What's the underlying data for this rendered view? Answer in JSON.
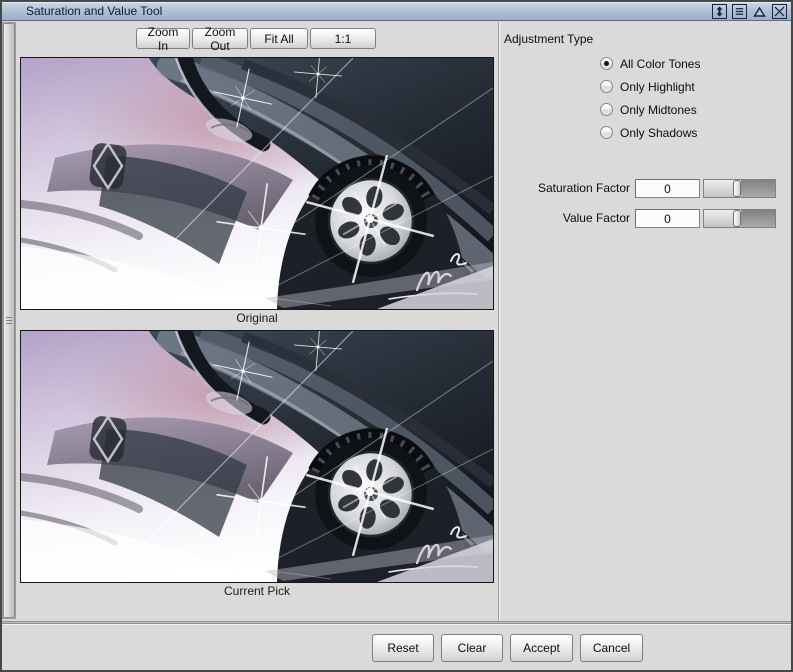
{
  "window": {
    "title": "Saturation and Value Tool",
    "controls": [
      "resize-vertical",
      "window-menu",
      "shade",
      "close"
    ]
  },
  "toolbar": {
    "buttons": [
      "Zoom In",
      "Zoom Out",
      "Fit All",
      "1:1"
    ]
  },
  "previews": {
    "content": "concept-car-sketch-minivan-front-wheel",
    "items": [
      {
        "label": "Original"
      },
      {
        "label": "Current Pick"
      }
    ]
  },
  "adjustment": {
    "group_label": "Adjustment Type",
    "options": [
      {
        "label": "All Color Tones",
        "selected": true
      },
      {
        "label": "Only Highlight",
        "selected": false
      },
      {
        "label": "Only Midtones",
        "selected": false
      },
      {
        "label": "Only Shadows",
        "selected": false
      }
    ]
  },
  "factors": [
    {
      "label": "Saturation Factor",
      "value": "0",
      "handle_pct": 41
    },
    {
      "label": "Value Factor",
      "value": "0",
      "handle_pct": 41
    }
  ],
  "actions": {
    "buttons": [
      "Reset",
      "Clear",
      "Accept",
      "Cancel"
    ]
  },
  "colors": {
    "titlebar_top": "#ccd6e4",
    "titlebar_mid": "#aebfd3",
    "titlebar_bottom": "#9db0c7",
    "titlebar_text": "#101c33",
    "window_bg": "#dadada",
    "frame": "#474747"
  }
}
